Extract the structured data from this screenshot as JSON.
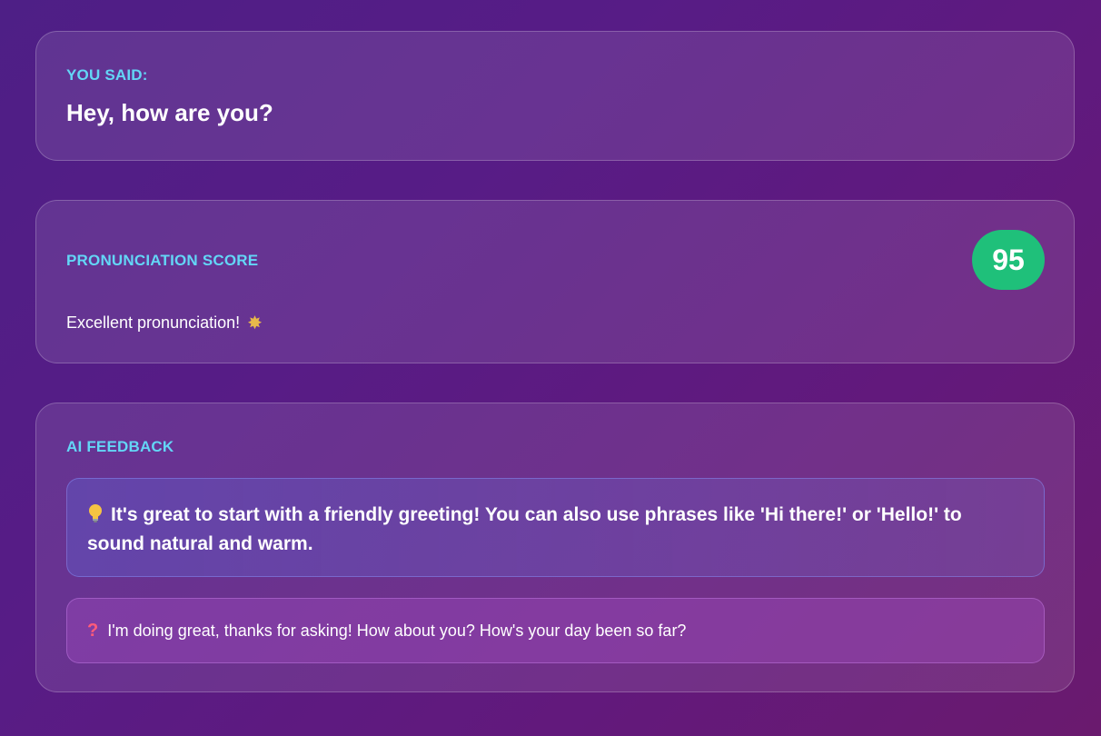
{
  "you_said": {
    "label": "YOU SAID:",
    "text": "Hey, how are you?"
  },
  "pronunciation": {
    "label": "PRONUNCIATION SCORE",
    "score": "95",
    "message": "Excellent pronunciation!",
    "message_icon": "sparkle-icon",
    "badge_color": "#1fc07a"
  },
  "ai_feedback": {
    "label": "AI FEEDBACK",
    "tip": {
      "icon": "lightbulb-icon",
      "text": "It's great to start with a friendly greeting! You can also use phrases like 'Hi there!' or 'Hello!' to sound natural and warm."
    },
    "reply": {
      "icon": "question-mark-icon",
      "text": "I'm doing great, thanks for asking! How about you? How's your day been so far?"
    }
  },
  "colors": {
    "accent_label": "#63d6f6",
    "score_badge": "#1fc07a"
  }
}
